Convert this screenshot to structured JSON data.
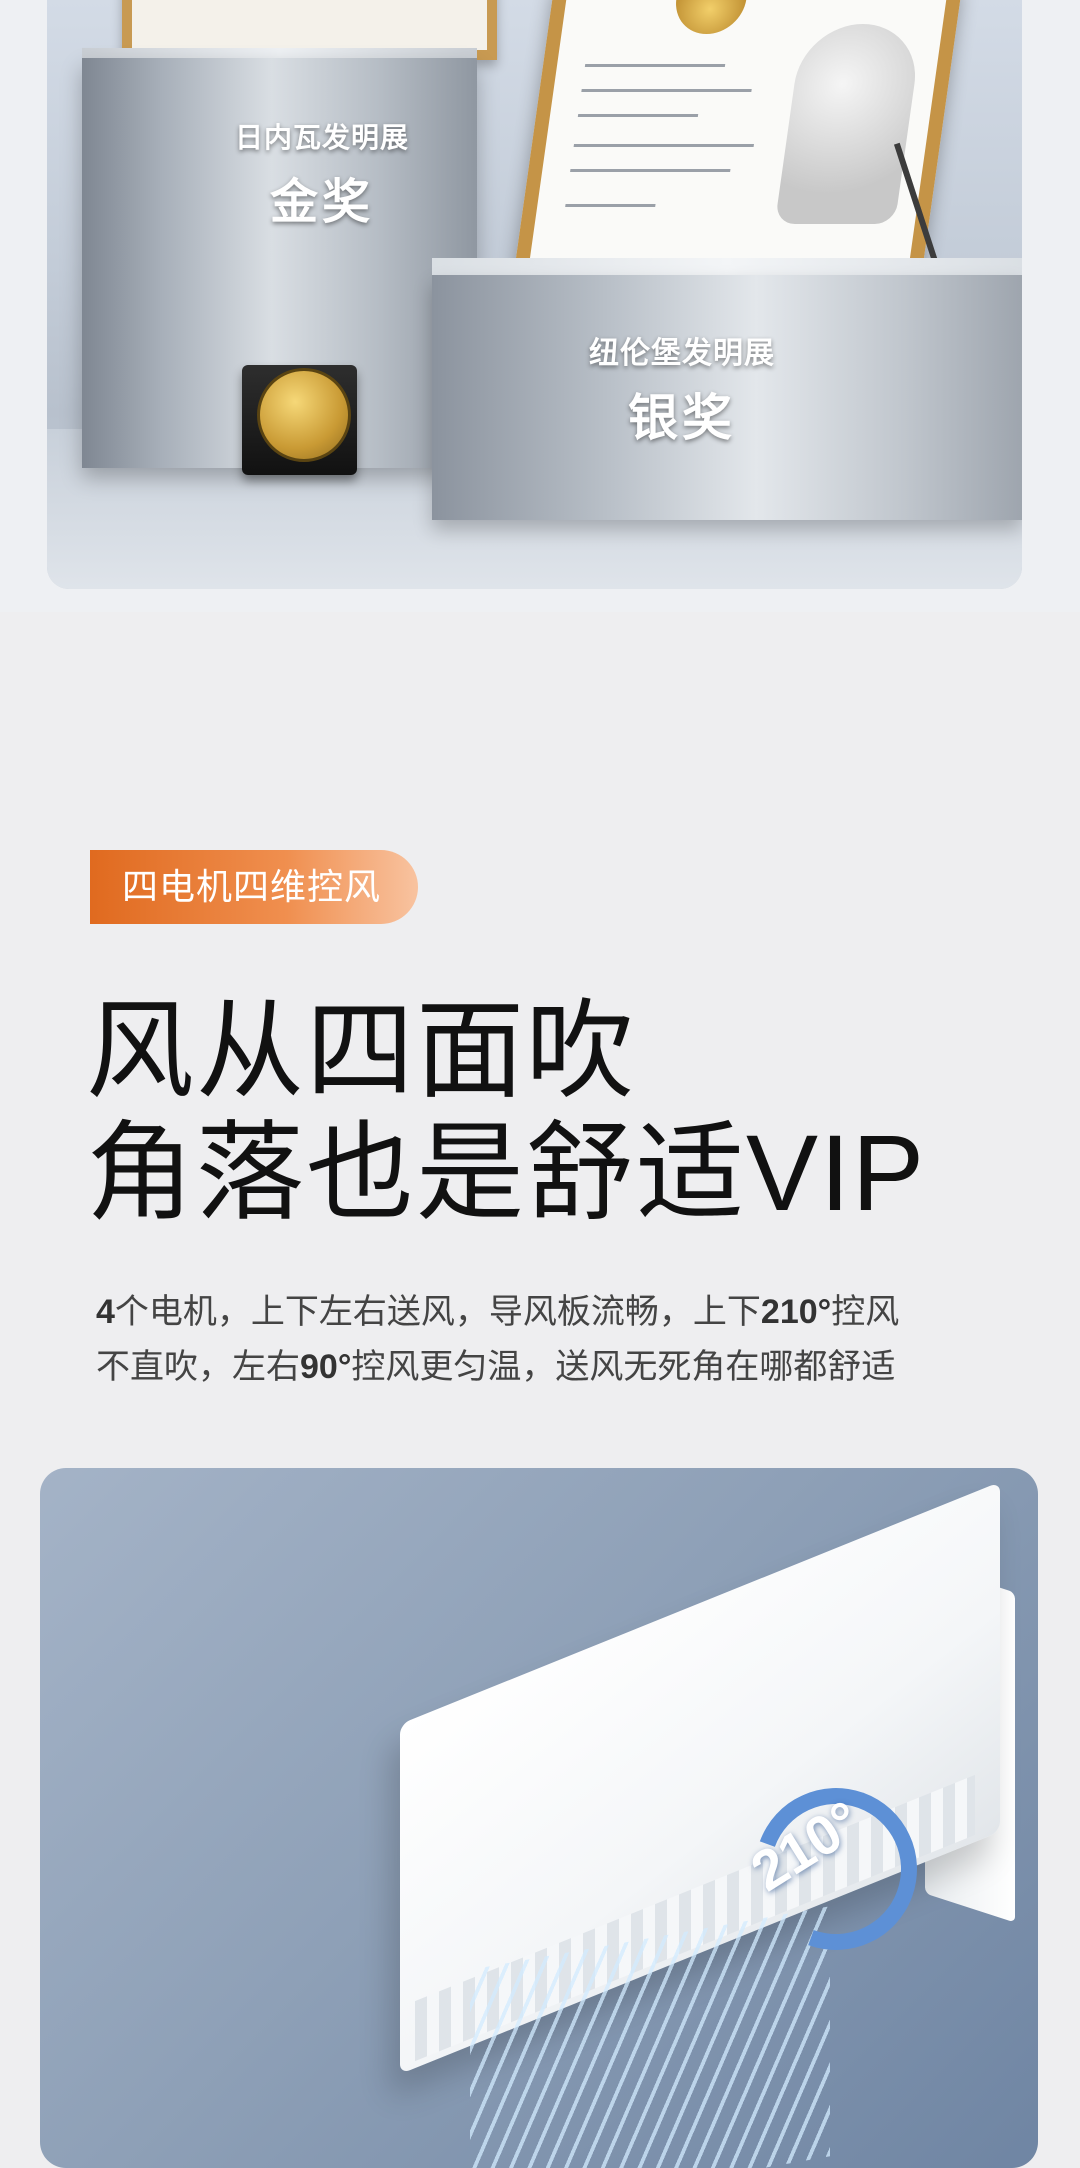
{
  "awards": {
    "left_award_event": "日内瓦发明展",
    "left_award_prize": "金奖",
    "right_award_event": "纽伦堡发明展",
    "right_award_prize": "银奖"
  },
  "feature": {
    "tag": "四电机四维控风",
    "headline_line1": "风从四面吹",
    "headline_line2": "角落也是舒适VIP",
    "desc_1": "4",
    "desc_2": "个电机，上下左右送风，导风板流畅，上下",
    "desc_3": "210°",
    "desc_4": "控风",
    "desc_5": "不直吹，左右",
    "desc_6": "90°",
    "desc_7": "控风更匀温，送风无死角在哪都舒适"
  },
  "product": {
    "angle_badge": "210°"
  },
  "colors": {
    "tag_gradient_start": "#e06a1f",
    "tag_gradient_end": "#f8c3a0",
    "page_background": "#eeeef0",
    "badge_blue": "#5d90d6"
  }
}
